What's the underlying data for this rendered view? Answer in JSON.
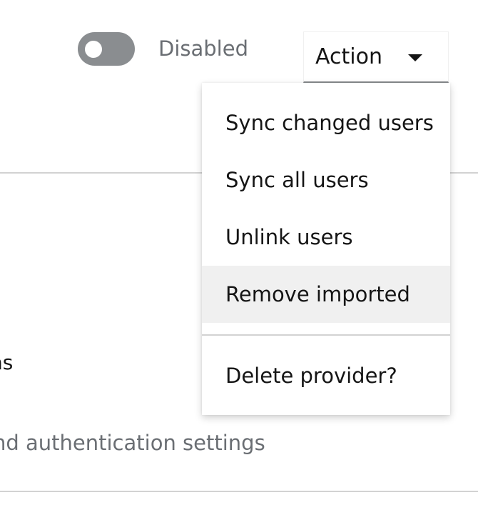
{
  "header": {
    "toggle_label": "Disabled",
    "toggle_on": false,
    "action_label": "Action"
  },
  "menu": {
    "items": [
      "Sync changed users",
      "Sync all users",
      "Unlink users",
      "Remove imported",
      "Delete provider?"
    ],
    "highlighted_index": 3
  },
  "background": {
    "partial_text_1": "ns",
    "partial_text_2": "nd authentication settings"
  },
  "colors": {
    "toggle_off": "#8a8d90",
    "hover_bg": "#f0f0f0",
    "muted_text": "#6a6e73"
  }
}
